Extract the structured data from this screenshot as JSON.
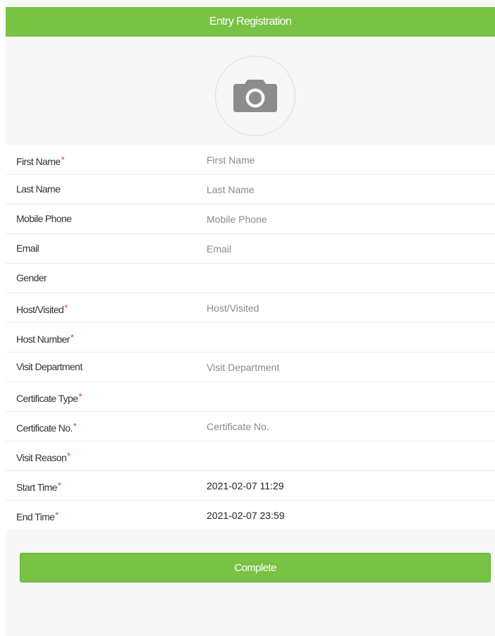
{
  "header": {
    "title": "Entry Registration"
  },
  "photo": {
    "icon": "camera-icon"
  },
  "form": {
    "first_name": {
      "label": "First Name",
      "required_mark": "*",
      "placeholder": "First Name",
      "value": ""
    },
    "last_name": {
      "label": "Last Name",
      "placeholder": "Last Name",
      "value": ""
    },
    "mobile_phone": {
      "label": "Mobile Phone",
      "placeholder": "Mobile Phone",
      "value": ""
    },
    "email": {
      "label": "Email",
      "placeholder": "Email",
      "value": ""
    },
    "gender": {
      "label": "Gender",
      "value": ""
    },
    "host_visited": {
      "label": "Host/Visited",
      "required_mark": "*",
      "placeholder": "Host/Visited",
      "value": ""
    },
    "host_number": {
      "label": "Host Number",
      "required_mark": "*",
      "value": ""
    },
    "visit_department": {
      "label": "Visit Department",
      "placeholder": "Visit Department",
      "value": ""
    },
    "certificate_type": {
      "label": "Certificate Type",
      "required_mark": "*",
      "value": ""
    },
    "certificate_no": {
      "label": "Certificate No.",
      "required_mark": "*",
      "placeholder": "Certificate No.",
      "value": ""
    },
    "visit_reason": {
      "label": "Visit Reason",
      "required_mark": "*",
      "value": ""
    },
    "start_time": {
      "label": "Start Time",
      "required_mark": "*",
      "value": "2021-02-07 11:29"
    },
    "end_time": {
      "label": "End Time",
      "required_mark": "*",
      "value": "2021-02-07 23:59"
    }
  },
  "actions": {
    "complete_label": "Complete"
  },
  "colors": {
    "accent": "#78c244",
    "required": "#e53935",
    "background": "#f7f7f7",
    "icon": "#8c8c8c"
  }
}
